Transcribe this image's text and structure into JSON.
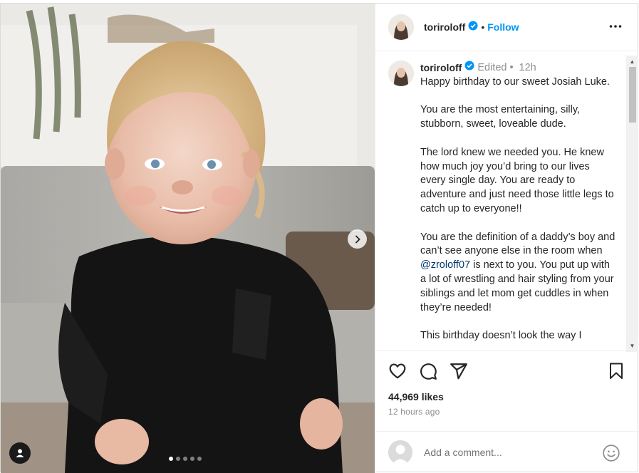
{
  "post": {
    "username": "toriroloff",
    "follow_label": "Follow",
    "header_separator": "•",
    "edited_label": "Edited",
    "caption_separator": "•",
    "age": "12h",
    "caption": [
      "Happy birthday to our sweet Josiah Luke.",
      "You are the most entertaining, silly, stubborn, sweet, loveable dude.",
      "The lord knew we needed you. He knew how much joy you’d bring to our lives every single day. You are ready to adventure and just need those little legs to catch up to everyone!!"
    ],
    "caption_p4_before": "You are the definition of a daddy’s boy and can’t see anyone else in the room when ",
    "caption_mention": "@zroloff07",
    "caption_p4_after": " is next to you. You put up with a lot of wrestling and hair styling from your siblings and let mom get cuddles in when they’re needed!",
    "caption_cut": "This birthday doesn’t look the way I",
    "likes": "44,969 likes",
    "timestamp": "12 hours ago",
    "comment_placeholder": "Add a comment...",
    "carousel": {
      "count": 5,
      "active_index": 0
    }
  },
  "icons": {
    "more": "more-options-icon",
    "verified": "verified-badge-icon",
    "like": "heart-icon",
    "comment": "comment-icon",
    "share": "share-icon",
    "save": "bookmark-icon",
    "emoji": "emoji-icon",
    "next": "chevron-right-icon",
    "tag": "user-tag-icon"
  },
  "colors": {
    "link": "#0095f6",
    "verified": "#0095f6",
    "mention": "#00376b",
    "muted": "#8e8e8e"
  }
}
